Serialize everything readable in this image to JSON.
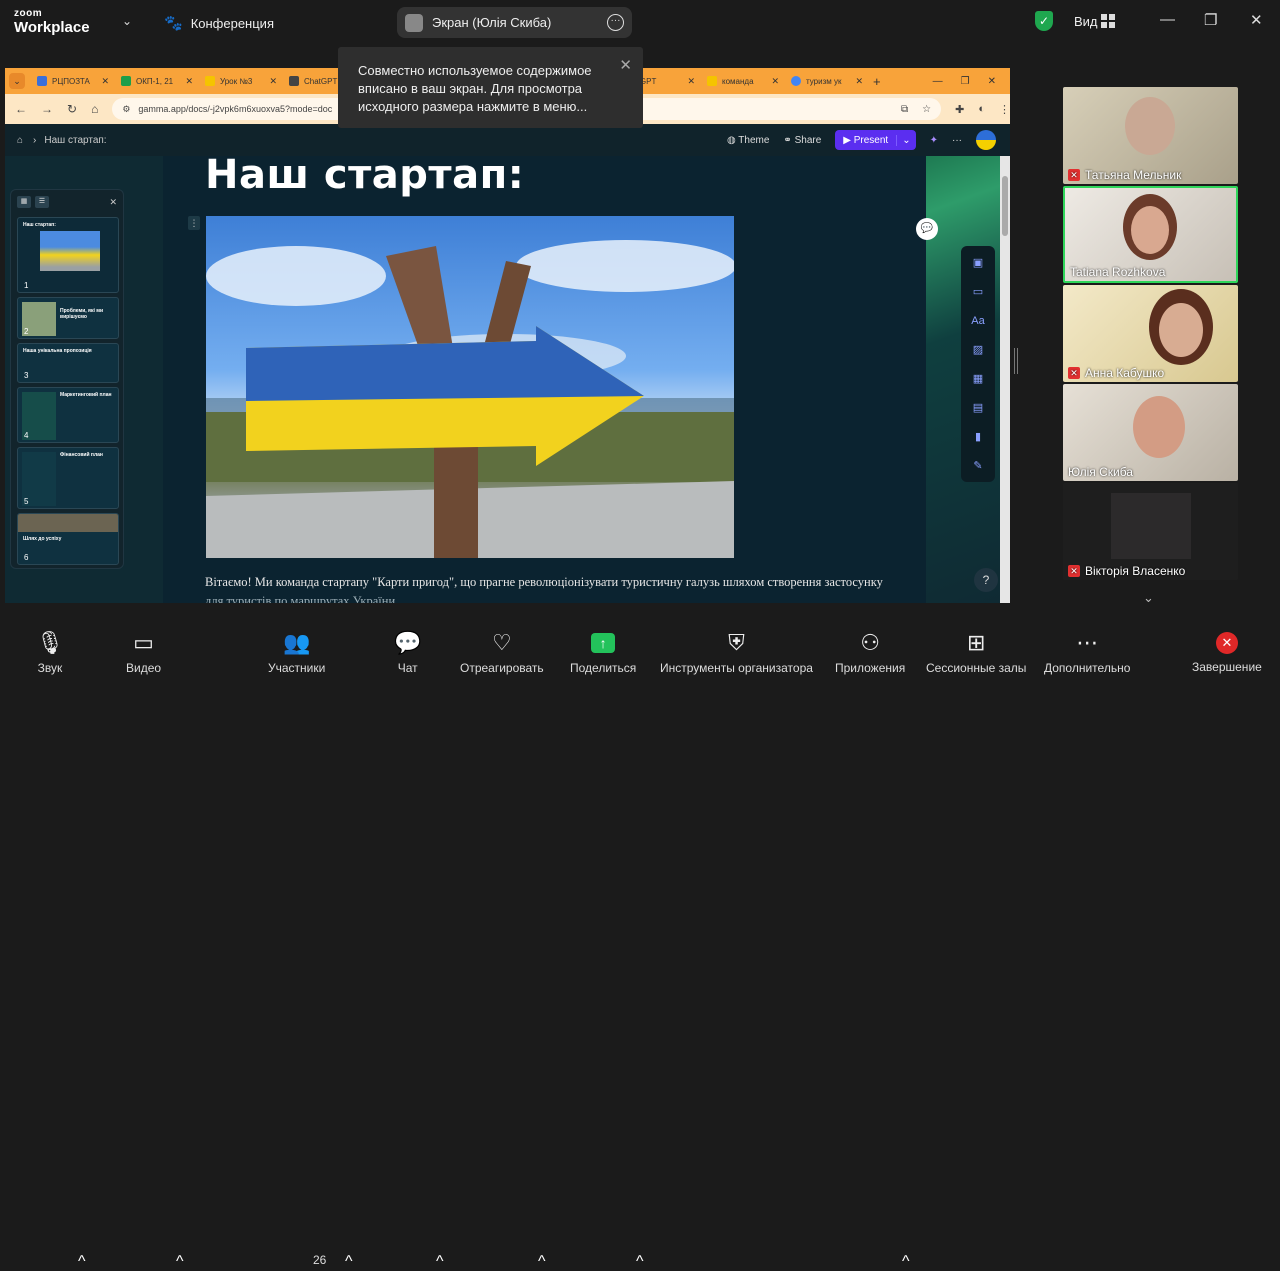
{
  "app": {
    "brand_top": "zoom",
    "brand_bottom": "Workplace",
    "meeting_title": "Конференция"
  },
  "screen_share": {
    "label": "Экран (Юлія Скиба)"
  },
  "top_right": {
    "view_label": "Вид"
  },
  "popup": {
    "text": "Совместно используемое содержимое вписано в ваш экран. Для просмотра исходного размера нажмите в меню..."
  },
  "browser": {
    "tabs": [
      {
        "label": "РЦПОЗТА",
        "color": "#3b6fd8"
      },
      {
        "label": "ОКП-1, 21",
        "color": "#1e9e4a"
      },
      {
        "label": "Урок №3",
        "color": "#f5c400"
      },
      {
        "label": "ChatGPT",
        "color": "#444444"
      },
      {
        "label": "",
        "color": "#444444"
      },
      {
        "label": "ChatGPT",
        "color": "#444444"
      },
      {
        "label": "команда",
        "color": "#f5c400"
      },
      {
        "label": "туризм ук",
        "color": "#4285f4"
      }
    ],
    "url": "gamma.app/docs/-j2vpk6m6xuoxva5?mode=doc"
  },
  "gamma": {
    "breadcrumb": "Наш стартап:",
    "theme_label": "Theme",
    "share_label": "Share",
    "present_label": "Present"
  },
  "slide": {
    "title": "Наш стартап:",
    "body_line1": "Вітаємо! Ми команда стартапу \"Карти пригод\", що прагне революціонізувати туристичну галузь шляхом створення застосунку",
    "body_line2": "для туристів по маршрутах України."
  },
  "thumbnails": [
    {
      "num": "1",
      "title": "Наш стартап:"
    },
    {
      "num": "2",
      "title": "Проблеми, які ми вирішуємо"
    },
    {
      "num": "3",
      "title": "Наша унікальна пропозиція"
    },
    {
      "num": "4",
      "title": "Маркетинговий план"
    },
    {
      "num": "5",
      "title": "Фінансовий план"
    },
    {
      "num": "6",
      "title": "Шлях до успіху"
    }
  ],
  "help_label": "?",
  "participants": [
    {
      "name": "Татьяна Мельник",
      "muted": true
    },
    {
      "name": "Tatiana Rozhkova",
      "muted": false,
      "active": true
    },
    {
      "name": "Анна Кабушко",
      "muted": true
    },
    {
      "name": "Юлія Скиба",
      "muted": false
    },
    {
      "name": "Вікторія Власенко",
      "muted": true
    }
  ],
  "toolbar": {
    "audio": "Звук",
    "video": "Видео",
    "participants": "Участники",
    "participants_count": "26",
    "chat": "Чат",
    "react": "Отреагировать",
    "share": "Поделиться",
    "host_tools": "Инструменты организатора",
    "apps": "Приложения",
    "breakout": "Сессионные залы",
    "more": "Дополнительно",
    "end": "Завершение"
  },
  "colors": {
    "accent_green": "#23c25b",
    "end_red": "#e02828",
    "present_purple": "#5b2ef0",
    "browser_tab_orange": "#f8a33a"
  }
}
